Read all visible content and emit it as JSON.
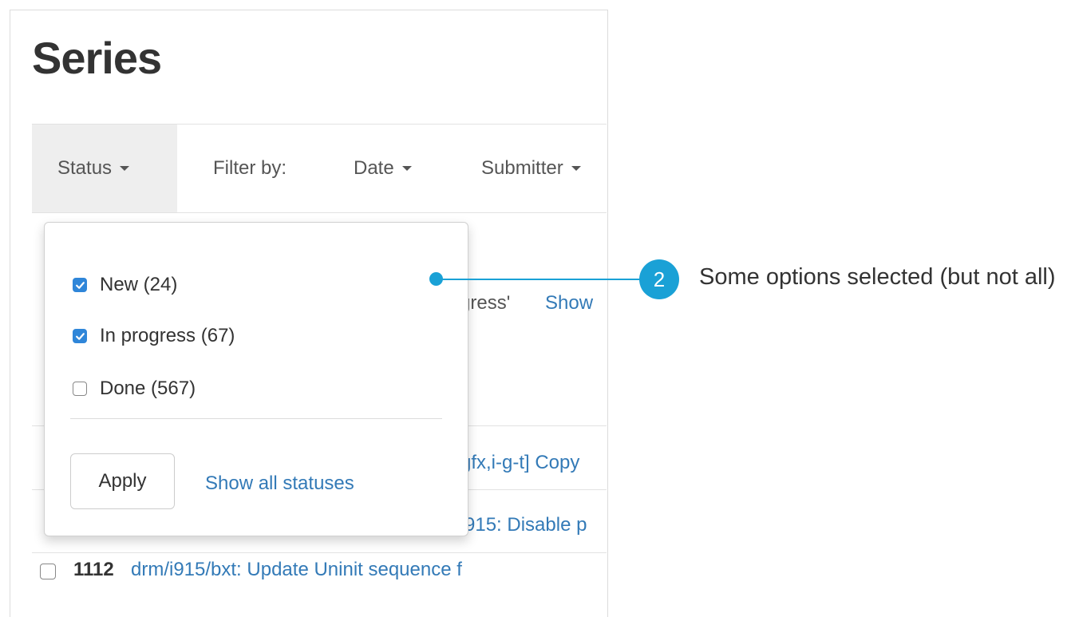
{
  "page": {
    "title": "Series"
  },
  "filter_bar": {
    "status_label": "Status",
    "filter_by_label": "Filter by:",
    "date_label": "Date",
    "submitter_label": "Submitter"
  },
  "background_fragments": {
    "progress_text": "gress'",
    "show_text": "Show",
    "row1_title": "gfx,i-g-t] Copy",
    "row2_title": "915: Disable p"
  },
  "list_rows": [
    {
      "id": "1112",
      "title": "drm/i915/bxt: Update Uninit sequence f"
    }
  ],
  "status_dropdown": {
    "options": [
      {
        "label": "New (24)",
        "checked": true
      },
      {
        "label": "In progress (67)",
        "checked": true
      },
      {
        "label": "Done (567)",
        "checked": false
      }
    ],
    "apply_label": "Apply",
    "show_all_label": "Show all statuses"
  },
  "callout": {
    "number": "2",
    "text": "Some options selected (but not all)"
  },
  "colors": {
    "accent": "#1aa1d6",
    "link": "#337ab7",
    "checkbox_checked": "#2f86d9"
  }
}
